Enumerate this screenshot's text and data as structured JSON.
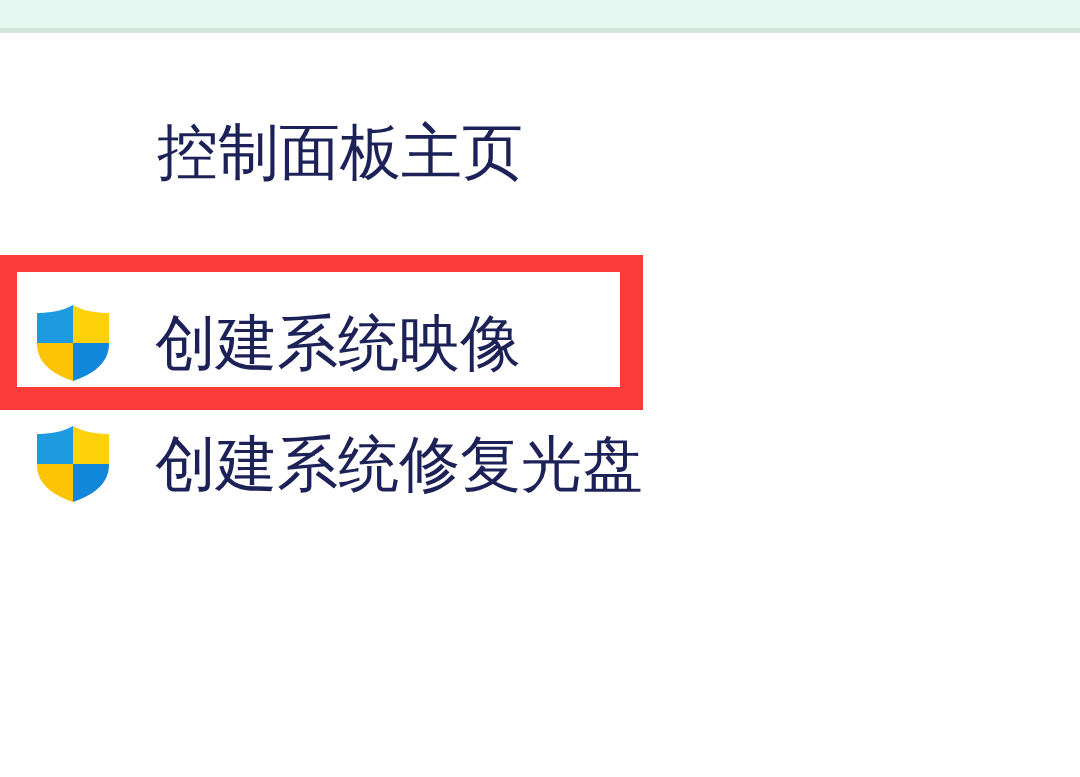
{
  "sidebar": {
    "home_link": "控制面板主页",
    "tasks": [
      {
        "label": "创建系统映像",
        "highlighted": true
      },
      {
        "label": "创建系统修复光盘",
        "highlighted": false
      }
    ]
  }
}
